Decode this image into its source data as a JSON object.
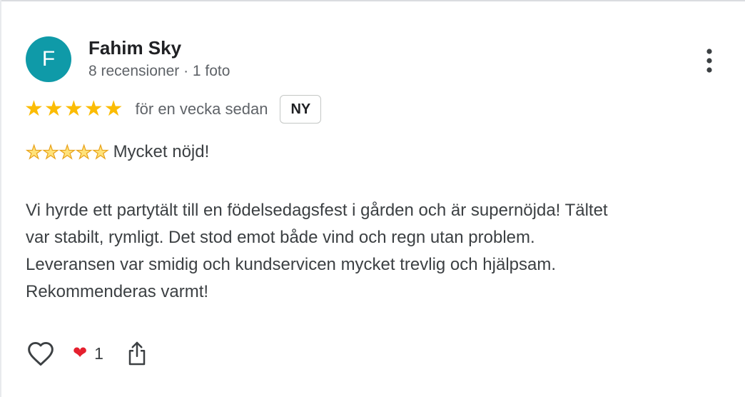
{
  "author": {
    "initial": "F",
    "name": "Fahim Sky",
    "meta": "8 recensioner · 1 foto",
    "avatar_color": "#0f9aa8"
  },
  "menu": {
    "icon": "more-vertical-icon"
  },
  "rating": {
    "stars": 5,
    "max_stars": 5,
    "star_color": "#fbbc04",
    "time": "för en vecka sedan",
    "badge": "NY"
  },
  "review": {
    "headline_emoji_stars": 5,
    "headline": "Mycket nöjd!",
    "lines": [
      "Vi hyrde ett partytält till en födelsedagsfest i gården och är supernöjda! Tältet",
      "var stabilt, rymligt. Det stod emot både vind och regn utan problem.",
      "Leveransen var smidig och kundservicen mycket trevlig och hjälpsam.",
      "Rekommenderas varmt!"
    ]
  },
  "actions": {
    "like_icon": "heart-outline-icon",
    "reaction_icon": "red-heart-icon",
    "reaction_count": "1",
    "share_icon": "share-icon"
  }
}
